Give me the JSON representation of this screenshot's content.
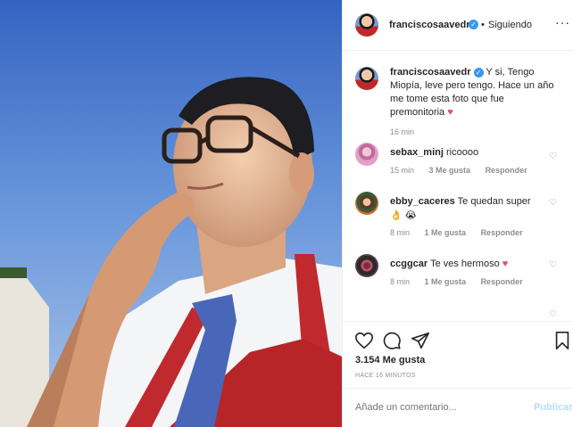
{
  "post": {
    "username": "franciscosaavedr",
    "follow_status": "Siguiendo",
    "verified_mark": "✓",
    "separator": "•",
    "more_label": "···",
    "caption_text": "Y si, Tengo Miopía, leve pero tengo. Hace un año me tome esta foto que fue premonitoria",
    "caption_time": "16 min"
  },
  "comments": [
    {
      "user": "sebax_minj",
      "text": "ricoooo",
      "time": "15 min",
      "likes": "3 Me gusta",
      "reply": "Responder"
    },
    {
      "user": "ebby_caceres",
      "text": "Te quedan super",
      "emoji": "👌 😭",
      "time": "8 min",
      "likes": "1 Me gusta",
      "reply": "Responder"
    },
    {
      "user": "ccggcar",
      "text": "Te ves hermoso",
      "time": "8 min",
      "likes": "1 Me gusta",
      "reply": "Responder"
    }
  ],
  "actions": {
    "likes_count": "3.154 Me gusta",
    "posted_ago": "HACE 16 MINUTOS"
  },
  "add_comment": {
    "placeholder": "Añade un comentario...",
    "publish_label": "Publicar"
  },
  "colors": {
    "heart_red": "#ed4956",
    "verified_blue": "#3897f0",
    "publish_disabled": "#b2dffc"
  }
}
